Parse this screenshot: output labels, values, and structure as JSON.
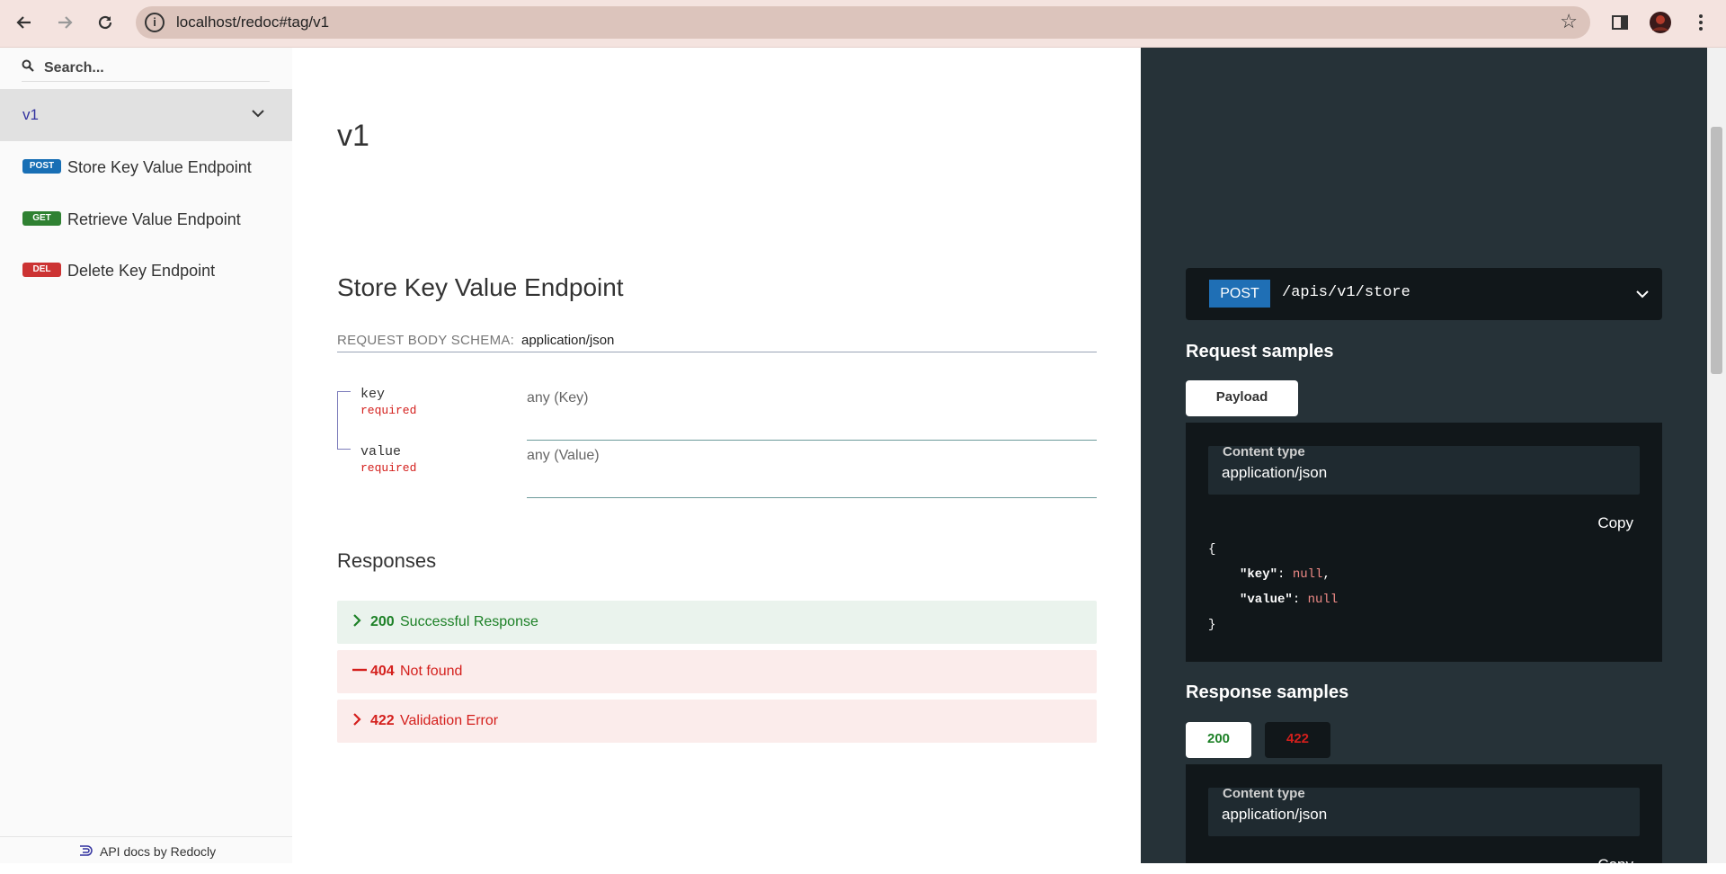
{
  "browser": {
    "url": "localhost/redoc#tag/v1"
  },
  "sidebar": {
    "search_placeholder": "Search...",
    "tag_label": "v1",
    "items": [
      {
        "method": "POST",
        "label": "Store Key Value Endpoint",
        "color": "#186fb5"
      },
      {
        "method": "GET",
        "label": "Retrieve Value Endpoint",
        "color": "#2f8132"
      },
      {
        "method": "DEL",
        "label": "Delete Key Endpoint",
        "color": "#cc3333"
      }
    ],
    "footer": "API docs by Redocly"
  },
  "main": {
    "tag_title": "v1",
    "operation_title": "Store Key Value Endpoint",
    "request_body_label": "REQUEST BODY SCHEMA:",
    "request_body_type": "application/json",
    "fields": [
      {
        "name": "key",
        "required": "required",
        "type": "any (Key)"
      },
      {
        "name": "value",
        "required": "required",
        "type": "any (Value)"
      }
    ],
    "responses_title": "Responses",
    "responses": [
      {
        "code": "200",
        "description": "Successful Response",
        "icon": "chevron-right",
        "color": "#1d8127",
        "bg": "#eaf3ed"
      },
      {
        "code": "404",
        "description": "Not found",
        "icon": "dash",
        "color": "#d41f1c",
        "bg": "#fbeceb"
      },
      {
        "code": "422",
        "description": "Validation Error",
        "icon": "chevron-right",
        "color": "#d41f1c",
        "bg": "#fbeceb"
      }
    ]
  },
  "right": {
    "method": "POST",
    "path": "/apis/v1/store",
    "request_samples_title": "Request samples",
    "payload_tab": "Payload",
    "content_type_label": "Content type",
    "content_type_value": "application/json",
    "copy_label": "Copy",
    "code_open": "{",
    "code_key1": "\"key\"",
    "code_val1": "null",
    "code_key2": "\"value\"",
    "code_val2": "null",
    "code_close": "}",
    "response_samples_title": "Response samples",
    "response_tabs": [
      {
        "label": "200",
        "color": "#1d8127"
      },
      {
        "label": "422",
        "color": "#d41f1c"
      }
    ],
    "content_type_label_2": "Content type",
    "content_type_value_2": "application/json",
    "copy_label_2": "Copy"
  }
}
